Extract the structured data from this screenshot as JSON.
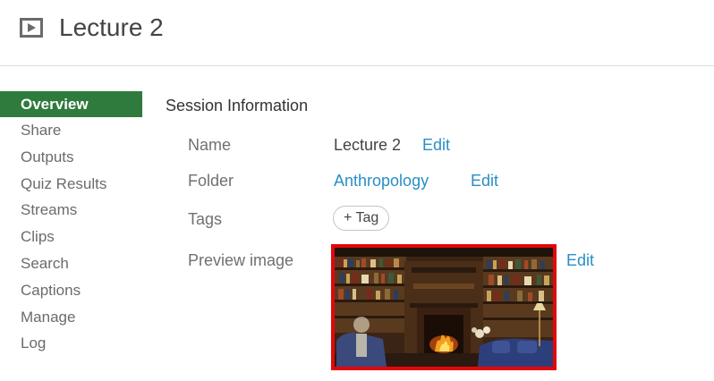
{
  "header": {
    "icon": "video-play-icon",
    "title": "Lecture 2"
  },
  "sidebar": {
    "items": [
      {
        "label": "Overview",
        "active": true
      },
      {
        "label": "Share"
      },
      {
        "label": "Outputs"
      },
      {
        "label": "Quiz Results"
      },
      {
        "label": "Streams"
      },
      {
        "label": "Clips"
      },
      {
        "label": "Search"
      },
      {
        "label": "Captions"
      },
      {
        "label": "Manage"
      },
      {
        "label": "Log"
      }
    ],
    "active_color": "#2f7a3d"
  },
  "main": {
    "section_title": "Session Information",
    "name": {
      "label": "Name",
      "value": "Lecture 2",
      "edit_label": "Edit"
    },
    "folder": {
      "label": "Folder",
      "value": "Anthropology",
      "edit_label": "Edit"
    },
    "tags": {
      "label": "Tags",
      "add_label": "+ Tag"
    },
    "preview_image": {
      "label": "Preview image",
      "edit_label": "Edit",
      "image": "library-fireplace-thumbnail",
      "border_color": "#e3060b"
    },
    "link_color": "#2a8ec6"
  }
}
